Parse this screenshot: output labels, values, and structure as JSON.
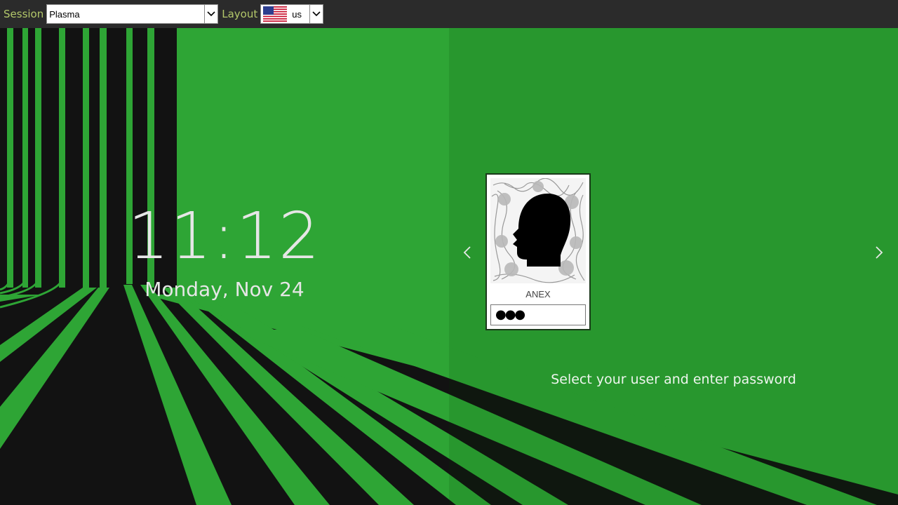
{
  "topbar": {
    "session_label": "Session",
    "session_value": "Plasma",
    "layout_label": "Layout",
    "layout_value": "us",
    "layout_flag": "us-flag-icon",
    "dropdown_icon": "chevron-down-icon"
  },
  "clock": {
    "time": "11:12",
    "date": "Monday, Nov 24"
  },
  "user": {
    "name": "ANEX",
    "avatar": "head-silhouette-avatar",
    "password_mask": "●●●"
  },
  "nav": {
    "prev_icon": "chevron-left-icon",
    "next_icon": "chevron-right-icon"
  },
  "prompt": "Select your user and enter password",
  "colors": {
    "green": "#2ea535",
    "black": "#121212",
    "topbar": "#2b2b2b",
    "label": "#b3c86a"
  }
}
